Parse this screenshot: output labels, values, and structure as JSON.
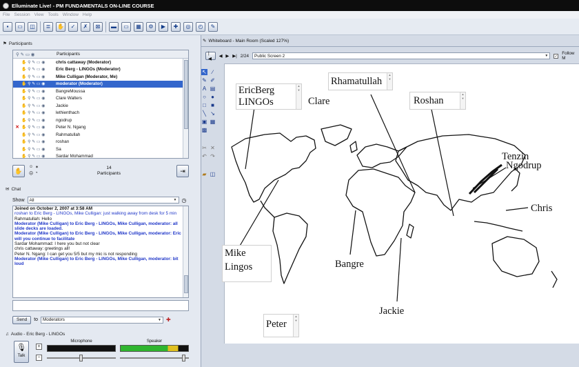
{
  "window": {
    "title": "Elluminate Live! - PM FUNDAMENTALS ON-LINE COURSE"
  },
  "menu": [
    "File",
    "Session",
    "View",
    "Tools",
    "Window",
    "Help"
  ],
  "participants": {
    "header": "Participants",
    "column_label": "Participants",
    "count": "14",
    "count_label": "Participants",
    "list": [
      {
        "name": "chris cattaway (Moderator)",
        "bold": true
      },
      {
        "name": "Eric Berg - LINGOs (Moderator)",
        "bold": true
      },
      {
        "name": "Mike Culligan (Moderator, Me)",
        "bold": true
      },
      {
        "name": "moderator (Moderator)",
        "bold": true,
        "selected": true
      },
      {
        "name": "BangreMoussa"
      },
      {
        "name": "Clare Walters"
      },
      {
        "name": "Jackie"
      },
      {
        "name": "lethienthach"
      },
      {
        "name": "ngodrup"
      },
      {
        "name": "Peter N. Ngang",
        "flag": "✕"
      },
      {
        "name": "Rahmatullah"
      },
      {
        "name": "roshan"
      },
      {
        "name": "Sa"
      },
      {
        "name": "Sardar Mohammad"
      }
    ]
  },
  "chat": {
    "header": "Chat",
    "show_label": "Show",
    "show_value": "All",
    "messages": [
      {
        "text": "Joined on October 2, 2007 at 3:58 AM",
        "style": "bold"
      },
      {
        "text": "roshan to Eric Berg - LINGOs, Mike Culligan: just walking away from desk for 5 min",
        "style": "blue"
      },
      {
        "text": "Rahmatullah: Hello",
        "style": "plain"
      },
      {
        "text": "Moderator (Mike Culligan) to Eric Berg - LINGOs, Mike Culligan, moderator: all slide decks are loaded.",
        "style": "bluebold"
      },
      {
        "text": "Moderator (Mike Culligan) to Eric Berg - LINGOs, Mike Culligan, moderator: Eric will you continue to facilitate",
        "style": "bluebold"
      },
      {
        "text": "Sardar Mohammad: I here you but not clear",
        "style": "plain"
      },
      {
        "text": "chris cattaway: greetings all!",
        "style": "plain"
      },
      {
        "text": "Peter N. Ngang: I can get you 5/5 but my mic is not responding",
        "style": "plain"
      },
      {
        "text": "Moderator (Mike Culligan) to Eric Berg - LINGOs, Mike Culligan, moderator: bit loud",
        "style": "bluebold"
      }
    ],
    "send_label": "Send",
    "to_label": "to",
    "to_value": "Moderators"
  },
  "audio": {
    "header": "Audio - Eric Berg - LINGOs",
    "talk_label": "Talk",
    "mic_label": "Microphone",
    "speaker_label": "Speaker"
  },
  "whiteboard": {
    "header": "Whiteboard - Main Room (Scaled 127%)",
    "page_indicator": "2/24",
    "screen_name": "Public Screen 2",
    "follow_label": "Follow M",
    "labels": {
      "ericberg_line1": "EricBerg",
      "ericberg_line2": "LINGOs",
      "clare": "Clare",
      "rhamatullah": "Rhamatullah",
      "roshan": "Roshan",
      "tenzin": "Tenzin",
      "ngodrup": "Ngodrup",
      "chris": "Chris",
      "mike_line1": "Mike",
      "mike_line2": "Lingos",
      "bangre": "Bangre",
      "jackie": "Jackie",
      "peter": "Peter"
    }
  },
  "colors": {
    "selection": "#3366cc",
    "chat_blue": "#1f36c8",
    "flag_red": "#cc0000"
  }
}
